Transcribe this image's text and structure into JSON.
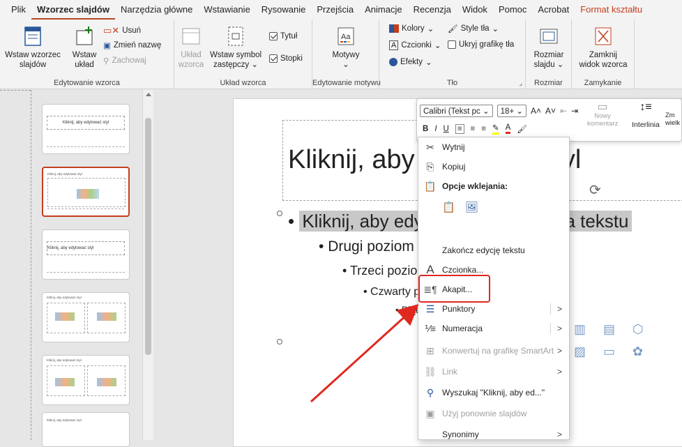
{
  "menu": {
    "tabs": [
      "Plik",
      "Wzorzec slajdów",
      "Narzędzia główne",
      "Wstawianie",
      "Rysowanie",
      "Przejścia",
      "Animacje",
      "Recenzja",
      "Widok",
      "Pomoc",
      "Acrobat",
      "Format kształtu"
    ],
    "active_tab": "Wzorzec slajdów",
    "contextual_tab": "Format kształtu",
    "contextual_color": "#c43e1c"
  },
  "ribbon": {
    "edit_master": {
      "label": "Edytowanie wzorca",
      "insert_master_l1": "Wstaw wzorzec",
      "insert_master_l2": "slajdów",
      "insert_layout_l1": "Wstaw",
      "insert_layout_l2": "układ",
      "delete": "Usuń",
      "rename": "Zmień nazwę",
      "preserve": "Zachowaj"
    },
    "layout": {
      "label": "Układ wzorca",
      "layout_l1": "Układ",
      "layout_l2": "wzorca",
      "placeholder_l1": "Wstaw symbol",
      "placeholder_l2": "zastępczy",
      "title": "Tytuł",
      "footers": "Stopki",
      "title_checked": true,
      "footers_checked": true
    },
    "theme": {
      "label": "Edytowanie motywu",
      "themes": "Motywy"
    },
    "background": {
      "label": "Tło",
      "colors": "Kolory",
      "fonts": "Czcionki",
      "effects": "Efekty",
      "bg_styles": "Style tła",
      "hide_bg": "Ukryj grafikę tła"
    },
    "size": {
      "label": "Rozmiar",
      "slide_size_l1": "Rozmiar",
      "slide_size_l2": "slajdu"
    },
    "close": {
      "label": "Zamykanie",
      "close_l1": "Zamknij",
      "close_l2": "widok wzorca"
    }
  },
  "thumbnails": [
    {
      "title": "Kliknij, aby edytować styl",
      "selected": false
    },
    {
      "title": "Kliknij, aby edytować styl",
      "selected": true
    },
    {
      "title": "Kliknij, aby edytować styl",
      "selected": false
    },
    {
      "title": "Kliknij, aby edytować styl",
      "selected": false
    },
    {
      "title": "Kliknij, aby edytować styl",
      "selected": false
    },
    {
      "title": "Kliknij, aby edytować styl",
      "selected": false
    }
  ],
  "slide": {
    "title": "Kliknij, aby edytować styl",
    "level1": "Kliknij, aby edytować style wzorca tekstu",
    "level2": "Drugi poziom",
    "level3": "Trzeci poziom",
    "level4": "Czwarty poziom",
    "level5": "Piąty poziom"
  },
  "mini_toolbar": {
    "font": "Calibri (Tekst pc",
    "size": "18+",
    "new_comment_l1": "Nowy",
    "new_comment_l2": "komentarz",
    "line_spacing": "Interlinia",
    "change_size_l1": "Zm",
    "change_size_l2": "wielk"
  },
  "context_menu": {
    "cut": "Wytnij",
    "copy": "Kopiuj",
    "paste_options": "Opcje wklejania:",
    "end_edit": "Zakończ edycję tekstu",
    "font": "Czcionka...",
    "paragraph": "Akapit...",
    "bullets": "Punktory",
    "numbering": "Numeracja",
    "smartart": "Konwertuj na grafikę SmartArt",
    "link": "Link",
    "search": "Wyszukaj \"Kliknij, aby ed...\"",
    "reuse": "Użyj ponownie slajdów",
    "synonyms": "Synonimy"
  },
  "colors": {
    "accent": "#b7472a",
    "highlight_box": "#e0281f",
    "arrow": "#e0281f"
  }
}
